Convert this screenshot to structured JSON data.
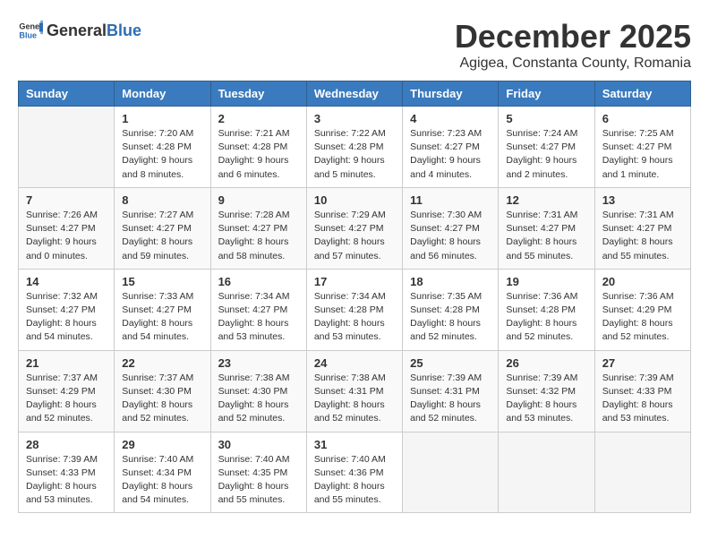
{
  "header": {
    "logo_general": "General",
    "logo_blue": "Blue",
    "month_title": "December 2025",
    "location": "Agigea, Constanta County, Romania"
  },
  "weekdays": [
    "Sunday",
    "Monday",
    "Tuesday",
    "Wednesday",
    "Thursday",
    "Friday",
    "Saturday"
  ],
  "weeks": [
    [
      {
        "day": "",
        "info": ""
      },
      {
        "day": "1",
        "info": "Sunrise: 7:20 AM\nSunset: 4:28 PM\nDaylight: 9 hours\nand 8 minutes."
      },
      {
        "day": "2",
        "info": "Sunrise: 7:21 AM\nSunset: 4:28 PM\nDaylight: 9 hours\nand 6 minutes."
      },
      {
        "day": "3",
        "info": "Sunrise: 7:22 AM\nSunset: 4:28 PM\nDaylight: 9 hours\nand 5 minutes."
      },
      {
        "day": "4",
        "info": "Sunrise: 7:23 AM\nSunset: 4:27 PM\nDaylight: 9 hours\nand 4 minutes."
      },
      {
        "day": "5",
        "info": "Sunrise: 7:24 AM\nSunset: 4:27 PM\nDaylight: 9 hours\nand 2 minutes."
      },
      {
        "day": "6",
        "info": "Sunrise: 7:25 AM\nSunset: 4:27 PM\nDaylight: 9 hours\nand 1 minute."
      }
    ],
    [
      {
        "day": "7",
        "info": "Sunrise: 7:26 AM\nSunset: 4:27 PM\nDaylight: 9 hours\nand 0 minutes."
      },
      {
        "day": "8",
        "info": "Sunrise: 7:27 AM\nSunset: 4:27 PM\nDaylight: 8 hours\nand 59 minutes."
      },
      {
        "day": "9",
        "info": "Sunrise: 7:28 AM\nSunset: 4:27 PM\nDaylight: 8 hours\nand 58 minutes."
      },
      {
        "day": "10",
        "info": "Sunrise: 7:29 AM\nSunset: 4:27 PM\nDaylight: 8 hours\nand 57 minutes."
      },
      {
        "day": "11",
        "info": "Sunrise: 7:30 AM\nSunset: 4:27 PM\nDaylight: 8 hours\nand 56 minutes."
      },
      {
        "day": "12",
        "info": "Sunrise: 7:31 AM\nSunset: 4:27 PM\nDaylight: 8 hours\nand 55 minutes."
      },
      {
        "day": "13",
        "info": "Sunrise: 7:31 AM\nSunset: 4:27 PM\nDaylight: 8 hours\nand 55 minutes."
      }
    ],
    [
      {
        "day": "14",
        "info": "Sunrise: 7:32 AM\nSunset: 4:27 PM\nDaylight: 8 hours\nand 54 minutes."
      },
      {
        "day": "15",
        "info": "Sunrise: 7:33 AM\nSunset: 4:27 PM\nDaylight: 8 hours\nand 54 minutes."
      },
      {
        "day": "16",
        "info": "Sunrise: 7:34 AM\nSunset: 4:27 PM\nDaylight: 8 hours\nand 53 minutes."
      },
      {
        "day": "17",
        "info": "Sunrise: 7:34 AM\nSunset: 4:28 PM\nDaylight: 8 hours\nand 53 minutes."
      },
      {
        "day": "18",
        "info": "Sunrise: 7:35 AM\nSunset: 4:28 PM\nDaylight: 8 hours\nand 52 minutes."
      },
      {
        "day": "19",
        "info": "Sunrise: 7:36 AM\nSunset: 4:28 PM\nDaylight: 8 hours\nand 52 minutes."
      },
      {
        "day": "20",
        "info": "Sunrise: 7:36 AM\nSunset: 4:29 PM\nDaylight: 8 hours\nand 52 minutes."
      }
    ],
    [
      {
        "day": "21",
        "info": "Sunrise: 7:37 AM\nSunset: 4:29 PM\nDaylight: 8 hours\nand 52 minutes."
      },
      {
        "day": "22",
        "info": "Sunrise: 7:37 AM\nSunset: 4:30 PM\nDaylight: 8 hours\nand 52 minutes."
      },
      {
        "day": "23",
        "info": "Sunrise: 7:38 AM\nSunset: 4:30 PM\nDaylight: 8 hours\nand 52 minutes."
      },
      {
        "day": "24",
        "info": "Sunrise: 7:38 AM\nSunset: 4:31 PM\nDaylight: 8 hours\nand 52 minutes."
      },
      {
        "day": "25",
        "info": "Sunrise: 7:39 AM\nSunset: 4:31 PM\nDaylight: 8 hours\nand 52 minutes."
      },
      {
        "day": "26",
        "info": "Sunrise: 7:39 AM\nSunset: 4:32 PM\nDaylight: 8 hours\nand 53 minutes."
      },
      {
        "day": "27",
        "info": "Sunrise: 7:39 AM\nSunset: 4:33 PM\nDaylight: 8 hours\nand 53 minutes."
      }
    ],
    [
      {
        "day": "28",
        "info": "Sunrise: 7:39 AM\nSunset: 4:33 PM\nDaylight: 8 hours\nand 53 minutes."
      },
      {
        "day": "29",
        "info": "Sunrise: 7:40 AM\nSunset: 4:34 PM\nDaylight: 8 hours\nand 54 minutes."
      },
      {
        "day": "30",
        "info": "Sunrise: 7:40 AM\nSunset: 4:35 PM\nDaylight: 8 hours\nand 55 minutes."
      },
      {
        "day": "31",
        "info": "Sunrise: 7:40 AM\nSunset: 4:36 PM\nDaylight: 8 hours\nand 55 minutes."
      },
      {
        "day": "",
        "info": ""
      },
      {
        "day": "",
        "info": ""
      },
      {
        "day": "",
        "info": ""
      }
    ]
  ]
}
